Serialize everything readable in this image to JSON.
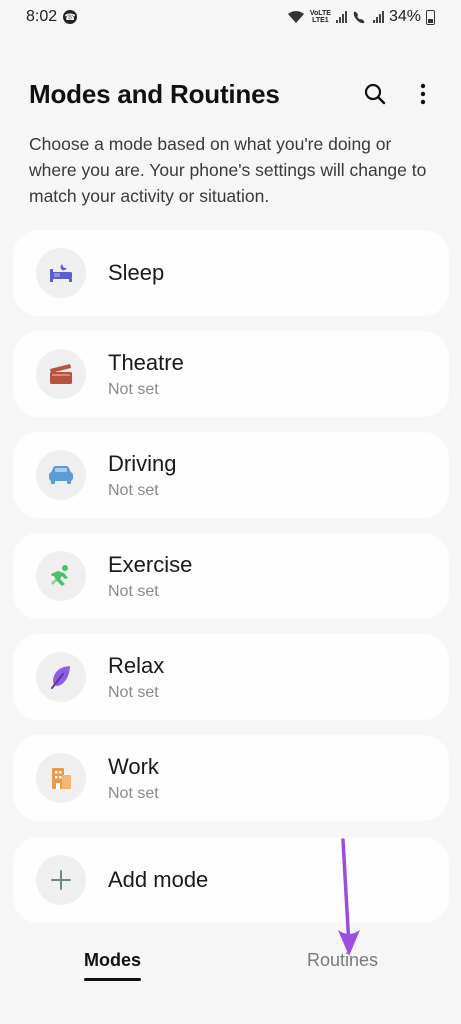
{
  "status_bar": {
    "time": "8:02",
    "network_top": "VoLTE",
    "network_bottom": "LTE1",
    "battery": "34%"
  },
  "header": {
    "title": "Modes and Routines",
    "search_icon": "search-icon",
    "more_icon": "more-vertical-icon"
  },
  "description": "Choose a mode based on what you're doing or where you are. Your phone's settings will change to match your activity or situation.",
  "modes": [
    {
      "name": "Sleep",
      "status": "",
      "icon": "bed-icon",
      "color": "#5b5fc7"
    },
    {
      "name": "Theatre",
      "status": "Not set",
      "icon": "clapperboard-icon",
      "color": "#b5533f"
    },
    {
      "name": "Driving",
      "status": "Not set",
      "icon": "car-icon",
      "color": "#5b9bd5"
    },
    {
      "name": "Exercise",
      "status": "Not set",
      "icon": "running-icon",
      "color": "#4cbf6a"
    },
    {
      "name": "Relax",
      "status": "Not set",
      "icon": "leaf-icon",
      "color": "#8d5ee0"
    },
    {
      "name": "Work",
      "status": "Not set",
      "icon": "building-icon",
      "color": "#e59a4f"
    },
    {
      "name": "Add mode",
      "status": "",
      "icon": "plus-icon",
      "color": "#6a8a80"
    }
  ],
  "tabs": {
    "modes": "Modes",
    "routines": "Routines"
  },
  "accent_color": "#9b4de0"
}
